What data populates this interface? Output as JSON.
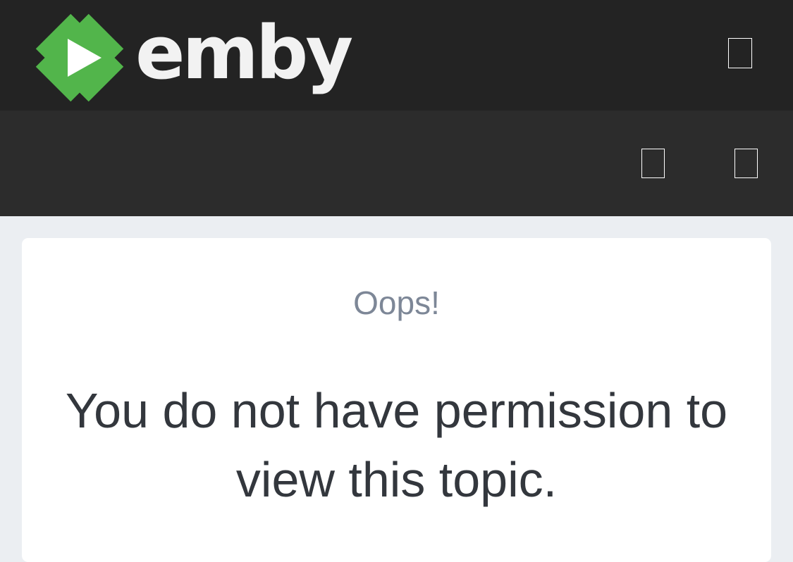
{
  "header": {
    "logo_text": "emby",
    "logo_color": "#52b54b",
    "menu_icon": "unrendered-glyph-box-icon"
  },
  "subheader": {
    "icons": [
      "unrendered-glyph-box-icon",
      "unrendered-glyph-box-icon"
    ]
  },
  "error": {
    "title": "Oops!",
    "message": "You do not have permission to view this topic."
  }
}
